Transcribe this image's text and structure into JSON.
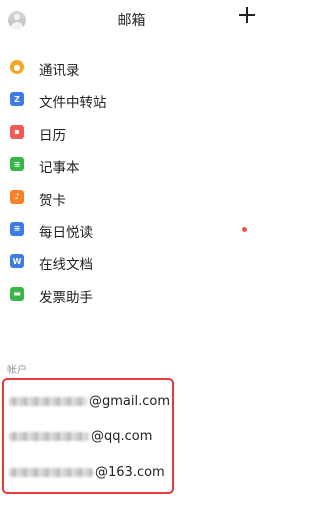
{
  "header": {
    "title": "邮箱"
  },
  "icons": {
    "avatar": "avatar-icon",
    "add": "plus-icon"
  },
  "menu": [
    {
      "label": "通讯录",
      "icon": "contacts-icon",
      "color": "#f5a623"
    },
    {
      "label": "文件中转站",
      "icon": "file-transfer-icon",
      "color": "#3d7be6"
    },
    {
      "label": "日历",
      "icon": "calendar-icon",
      "color": "#f05a5a"
    },
    {
      "label": "记事本",
      "icon": "notepad-icon",
      "color": "#39b54a"
    },
    {
      "label": "贺卡",
      "icon": "greeting-card-icon",
      "color": "#f6832b"
    },
    {
      "label": "每日悦读",
      "icon": "daily-reading-icon",
      "color": "#3d7be6",
      "badge": true
    },
    {
      "label": "在线文档",
      "icon": "online-docs-icon",
      "color": "#3d7be6"
    },
    {
      "label": "发票助手",
      "icon": "invoice-icon",
      "color": "#39b54a"
    }
  ],
  "section_label": "帐户",
  "accounts": [
    {
      "suffix": "@gmail.com"
    },
    {
      "suffix": "@qq.com"
    },
    {
      "suffix": "@163.com"
    }
  ],
  "colors": {
    "highlight_border": "#e5393d",
    "badge_dot": "#ef5350"
  }
}
